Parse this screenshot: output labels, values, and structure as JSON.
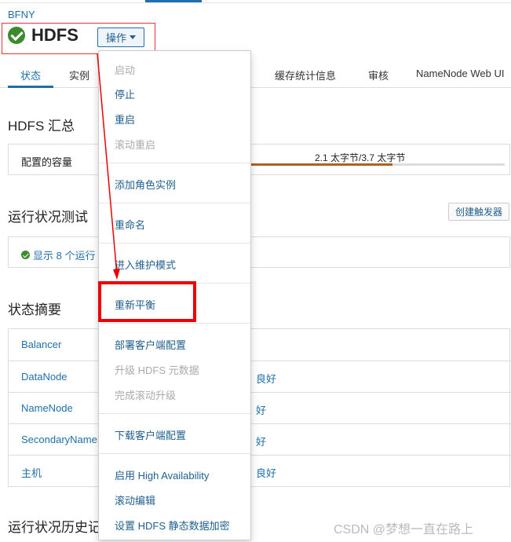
{
  "header": {
    "cluster": "BFNY",
    "service_title": "HDFS",
    "action_label": "操作"
  },
  "tabs": [
    {
      "label": "状态",
      "active": true
    },
    {
      "label": "实例"
    },
    {
      "label": "缓存统计信息"
    },
    {
      "label": "审核"
    },
    {
      "label": "NameNode Web UI"
    }
  ],
  "summary": {
    "title": "HDFS 汇总",
    "capacity_label": "配置的容量",
    "capacity_value": "2.1 太字节/3.7 太字节",
    "capacity_fraction": 0.57
  },
  "health": {
    "title": "运行状况测试",
    "create_trigger": "创建触发器",
    "show_link": "显示 8 个运行"
  },
  "status_summary": {
    "title": "状态摘要",
    "rows": [
      {
        "name": "Balancer",
        "status": ""
      },
      {
        "name": "DataNode",
        "status": "良好"
      },
      {
        "name": "NameNode",
        "status": "好"
      },
      {
        "name": "SecondaryNameN",
        "status": "好"
      },
      {
        "name": "主机",
        "status": "良好"
      }
    ]
  },
  "history": {
    "title": "运行状况历史记"
  },
  "menu": {
    "items": [
      {
        "label": "启动",
        "disabled": true
      },
      {
        "label": "停止"
      },
      {
        "label": "重启"
      },
      {
        "label": "滚动重启",
        "disabled": true
      },
      {
        "label": "添加角色实例"
      },
      {
        "label": "重命名"
      },
      {
        "label": "进入维护模式"
      },
      {
        "label": "重新平衡"
      },
      {
        "label": "部署客户端配置"
      },
      {
        "label": "升级 HDFS 元数据",
        "disabled": true
      },
      {
        "label": "完成滚动升级",
        "disabled": true
      },
      {
        "label": "下载客户端配置"
      },
      {
        "label": "启用 High Availability"
      },
      {
        "label": "滚动编辑"
      },
      {
        "label": "设置 HDFS 静态数据加密"
      }
    ]
  },
  "watermark": "CSDN @梦想一直在路上",
  "colors": {
    "accent": "#1f6fa8",
    "ok_green": "#3b8a2e",
    "annotation_red": "#e00000"
  }
}
